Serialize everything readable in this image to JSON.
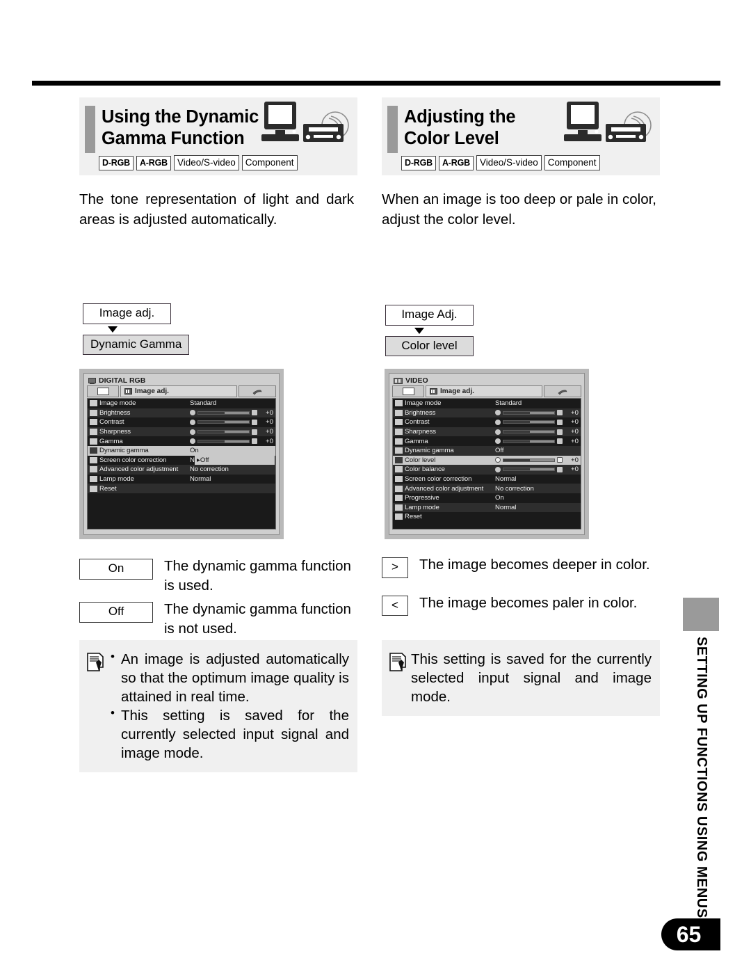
{
  "page": {
    "number": "65",
    "side_tab_text": "SETTING UP FUNCTIONS USING MENUS"
  },
  "sections": [
    {
      "title_line1": "Using the Dynamic",
      "title_line2": "Gamma Function",
      "tags": [
        "D-RGB",
        "A-RGB",
        "Video/S-video",
        "Component"
      ],
      "intro": "The tone representation of light and dark areas is adjusted automatically.",
      "nav": {
        "parent": "Image adj.",
        "child": "Dynamic Gamma"
      },
      "osd": {
        "signal": "DIGITAL RGB",
        "tab_label": "Image adj.",
        "rows": [
          {
            "label": "Image mode",
            "value": "Standard",
            "type": "text",
            "icon": "image-mode-icon"
          },
          {
            "label": "Brightness",
            "value": "+0",
            "type": "slider",
            "icon": "brightness-icon"
          },
          {
            "label": "Contrast",
            "value": "+0",
            "type": "slider",
            "icon": "contrast-icon"
          },
          {
            "label": "Sharpness",
            "value": "+0",
            "type": "slider",
            "icon": "sharpness-icon"
          },
          {
            "label": "Gamma",
            "value": "+0",
            "type": "slider",
            "icon": "gamma-icon"
          },
          {
            "label": "Dynamic gamma",
            "value": "On",
            "type": "text",
            "icon": "dynamic-gamma-icon",
            "selected": true
          },
          {
            "label": "Screen color correction",
            "value": "Normal",
            "type": "text",
            "icon": "screen-color-correction-icon"
          },
          {
            "label": "Advanced color adjustment",
            "value": "No correction",
            "type": "text",
            "icon": "advanced-color-icon"
          },
          {
            "label": "Lamp mode",
            "value": "Normal",
            "type": "text",
            "icon": "lamp-mode-icon"
          },
          {
            "label": "Reset",
            "value": "",
            "type": "text",
            "icon": "reset-icon"
          }
        ],
        "popup": {
          "marker": "▸",
          "label": "Off"
        }
      },
      "options": [
        {
          "key": "On",
          "text": "The dynamic gamma function is used."
        },
        {
          "key": "Off",
          "text": "The dynamic gamma function is not used."
        }
      ],
      "note_bullets": [
        "An image is adjusted automatically so that the optimum image quality is attained in real time.",
        "This setting is saved for the currently selected input signal and image mode."
      ]
    },
    {
      "title_line1": "Adjusting the",
      "title_line2": "Color Level",
      "tags": [
        "D-RGB",
        "A-RGB",
        "Video/S-video",
        "Component"
      ],
      "intro": "When an image is too deep or pale in color, adjust the color level.",
      "nav": {
        "parent": "Image Adj.",
        "child": "Color level"
      },
      "osd": {
        "signal": "VIDEO",
        "tab_label": "Image adj.",
        "rows": [
          {
            "label": "Image mode",
            "value": "Standard",
            "type": "text",
            "icon": "image-mode-icon"
          },
          {
            "label": "Brightness",
            "value": "+0",
            "type": "slider",
            "icon": "brightness-icon"
          },
          {
            "label": "Contrast",
            "value": "+0",
            "type": "slider",
            "icon": "contrast-icon"
          },
          {
            "label": "Sharpness",
            "value": "+0",
            "type": "slider",
            "icon": "sharpness-icon"
          },
          {
            "label": "Gamma",
            "value": "+0",
            "type": "slider",
            "icon": "gamma-icon"
          },
          {
            "label": "Dynamic gamma",
            "value": "Off",
            "type": "text",
            "icon": "dynamic-gamma-icon"
          },
          {
            "label": "Color level",
            "value": "+0",
            "type": "slider",
            "icon": "color-level-icon",
            "selected": true
          },
          {
            "label": "Color balance",
            "value": "+0",
            "type": "slider",
            "icon": "color-balance-icon"
          },
          {
            "label": "Screen color correction",
            "value": "Normal",
            "type": "text",
            "icon": "screen-color-correction-icon"
          },
          {
            "label": "Advanced color adjustment",
            "value": "No correction",
            "type": "text",
            "icon": "advanced-color-icon"
          },
          {
            "label": "Progressive",
            "value": "On",
            "type": "text",
            "icon": "progressive-icon"
          },
          {
            "label": "Lamp mode",
            "value": "Normal",
            "type": "text",
            "icon": "lamp-mode-icon"
          },
          {
            "label": "Reset",
            "value": "",
            "type": "text",
            "icon": "reset-icon"
          }
        ],
        "popup": null
      },
      "options": [
        {
          "key": ">",
          "text": "The image becomes deeper in color."
        },
        {
          "key": "<",
          "text": "The image becomes paler in color."
        }
      ],
      "note_paragraph": "This setting is saved for the currently selected input signal and image mode."
    }
  ]
}
